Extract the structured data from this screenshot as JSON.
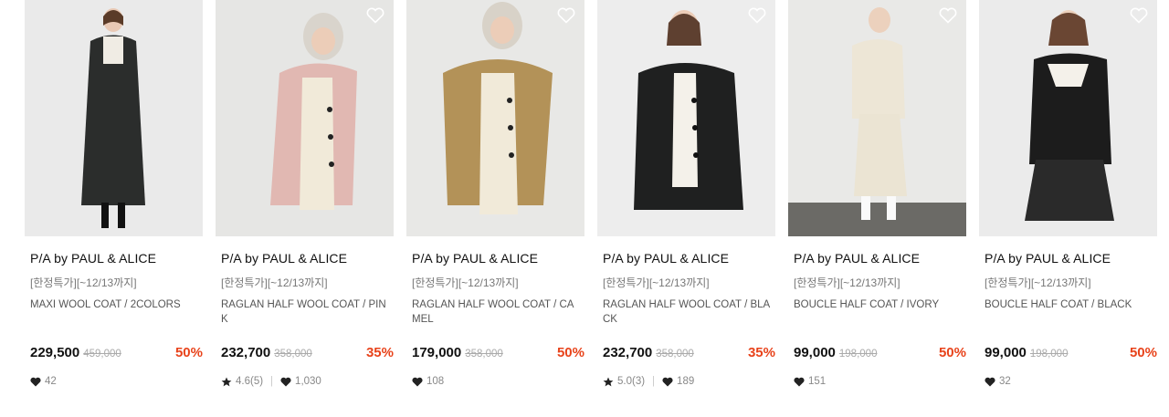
{
  "colors": {
    "discount": "#e8431b",
    "price": "#111111",
    "muted": "#888888"
  },
  "products": [
    {
      "brand": "P/A by PAUL & ALICE",
      "promo": "[한정특가][~12/13까지]",
      "name": "MAXI WOOL COAT / 2COLORS",
      "price": "229,500",
      "original_price": "459,000",
      "discount": "50%",
      "rating": null,
      "likes": "42",
      "coat_color": "#2b2d2c"
    },
    {
      "brand": "P/A by PAUL & ALICE",
      "promo": "[한정특가][~12/13까지]",
      "name": "RAGLAN HALF WOOL COAT / PINK",
      "price": "232,700",
      "original_price": "358,000",
      "discount": "35%",
      "rating": "4.6(5)",
      "likes": "1,030",
      "coat_color": "#e1b8b2"
    },
    {
      "brand": "P/A by PAUL & ALICE",
      "promo": "[한정특가][~12/13까지]",
      "name": "RAGLAN HALF WOOL COAT / CAMEL",
      "price": "179,000",
      "original_price": "358,000",
      "discount": "50%",
      "rating": null,
      "likes": "108",
      "coat_color": "#b39258"
    },
    {
      "brand": "P/A by PAUL & ALICE",
      "promo": "[한정특가][~12/13까지]",
      "name": "RAGLAN HALF WOOL COAT / BLACK",
      "price": "232,700",
      "original_price": "358,000",
      "discount": "35%",
      "rating": "5.0(3)",
      "likes": "189",
      "coat_color": "#1f2020"
    },
    {
      "brand": "P/A by PAUL & ALICE",
      "promo": "[한정특가][~12/13까지]",
      "name": "BOUCLE HALF COAT / IVORY",
      "price": "99,000",
      "original_price": "198,000",
      "discount": "50%",
      "rating": null,
      "likes": "151",
      "coat_color": "#ede6d6"
    },
    {
      "brand": "P/A by PAUL & ALICE",
      "promo": "[한정특가][~12/13까지]",
      "name": "BOUCLE HALF COAT / BLACK",
      "price": "99,000",
      "original_price": "198,000",
      "discount": "50%",
      "rating": null,
      "likes": "32",
      "coat_color": "#1c1c1c"
    }
  ]
}
